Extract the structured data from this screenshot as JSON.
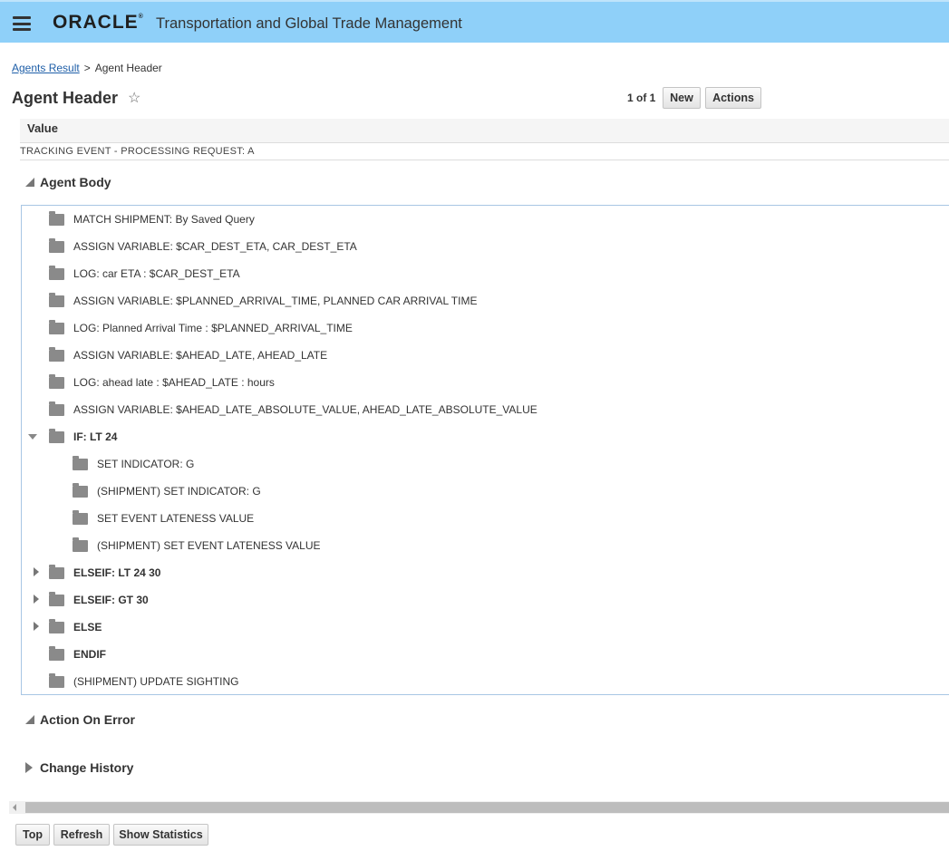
{
  "header": {
    "brand": "ORACLE",
    "brand_mark": "®",
    "app_title": "Transportation and Global Trade Management"
  },
  "breadcrumb": {
    "link": "Agents Result",
    "separator": ">",
    "current": "Agent Header"
  },
  "page": {
    "title": "Agent Header",
    "pager": "1 of 1",
    "new_label": "New",
    "actions_label": "Actions"
  },
  "value_table": {
    "header": "Value",
    "row": "TRACKING EVENT - PROCESSING REQUEST: A"
  },
  "agent_body": {
    "title": "Agent Body",
    "items": [
      {
        "label": "MATCH SHIPMENT: By Saved Query"
      },
      {
        "label": "ASSIGN VARIABLE: $CAR_DEST_ETA, CAR_DEST_ETA"
      },
      {
        "label": "LOG: car ETA : $CAR_DEST_ETA"
      },
      {
        "label": "ASSIGN VARIABLE: $PLANNED_ARRIVAL_TIME, PLANNED CAR ARRIVAL TIME"
      },
      {
        "label": "LOG: Planned Arrival Time : $PLANNED_ARRIVAL_TIME"
      },
      {
        "label": "ASSIGN VARIABLE: $AHEAD_LATE, AHEAD_LATE"
      },
      {
        "label": "LOG: ahead late : $AHEAD_LATE : hours"
      },
      {
        "label": "ASSIGN VARIABLE: $AHEAD_LATE_ABSOLUTE_VALUE, AHEAD_LATE_ABSOLUTE_VALUE"
      },
      {
        "label": "IF: LT 24"
      },
      {
        "label": "SET INDICATOR: G"
      },
      {
        "label": "(SHIPMENT) SET INDICATOR: G"
      },
      {
        "label": "SET EVENT LATENESS VALUE"
      },
      {
        "label": "(SHIPMENT) SET EVENT LATENESS VALUE"
      },
      {
        "label": "ELSEIF: LT 24 30"
      },
      {
        "label": "ELSEIF: GT 30"
      },
      {
        "label": "ELSE"
      },
      {
        "label": "ENDIF"
      },
      {
        "label": "(SHIPMENT) UPDATE SIGHTING"
      }
    ]
  },
  "sections": {
    "action_on_error": "Action On Error",
    "change_history": "Change History"
  },
  "footer": {
    "top_label": "Top",
    "refresh_label": "Refresh",
    "stats_label": "Show Statistics"
  }
}
